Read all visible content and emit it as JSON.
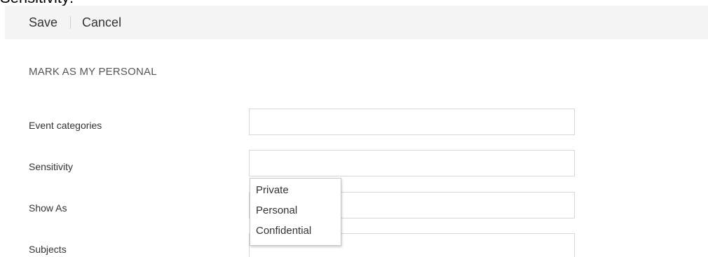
{
  "caption": "Sensitivity:",
  "toolbar": {
    "save_label": "Save",
    "cancel_label": "Cancel"
  },
  "section": {
    "heading": "MARK AS MY PERSONAL"
  },
  "fields": {
    "event_categories": {
      "label": "Event categories",
      "value": ""
    },
    "sensitivity": {
      "label": "Sensitivity",
      "value": ""
    },
    "show_as": {
      "label": "Show As",
      "value": ""
    },
    "subjects": {
      "label": "Subjects",
      "value": ""
    }
  },
  "sensitivity_options": [
    "Private",
    "Personal",
    "Confidential"
  ]
}
